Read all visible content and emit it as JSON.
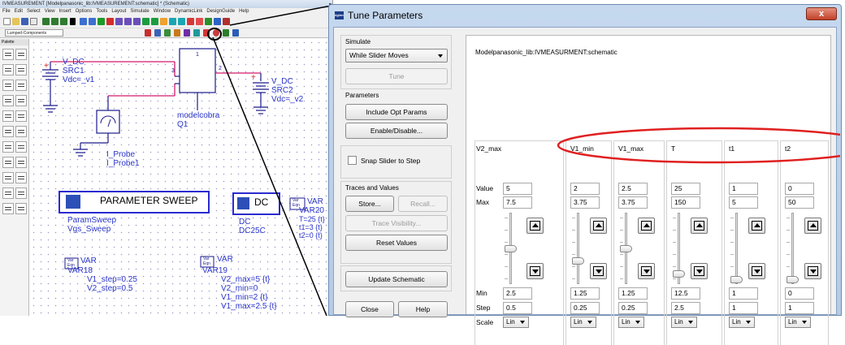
{
  "ads": {
    "window_title": "IVMEASUREMENT [Modelpanasonic_lib:IVMEASUREMENT:schematic] * (Schematic)",
    "menu": [
      "File",
      "Edit",
      "Select",
      "View",
      "Insert",
      "Options",
      "Tools",
      "Layout",
      "Simulate",
      "Window",
      "DynamicLink",
      "DesignGuide",
      "Help"
    ],
    "combo_value": "Lumped-Components",
    "palette_title": "Palette",
    "canvas": {
      "src1": {
        "name": "V_DC",
        "inst": "SRC1",
        "param": "Vdc=_v1"
      },
      "src2": {
        "name": "V_DC",
        "inst": "SRC2",
        "param": "Vdc=_v2"
      },
      "device": {
        "model": "modelcobra",
        "inst": "Q1",
        "pin1": "1",
        "pin2": "2",
        "pin3": "3"
      },
      "probe": {
        "name": "I_Probe",
        "inst": "I_Probe1"
      },
      "sweep": {
        "label": "PARAMETER SWEEP",
        "name": "ParamSweep",
        "inst": "Vgs_Sweep"
      },
      "dc": {
        "label": "DC",
        "name": "DC",
        "inst": "DC25C"
      },
      "var20": {
        "title": "VAR",
        "inst": "VAR20",
        "lines": [
          "T=25 {t}",
          "t1=3 {t}",
          "t2=0 {t}"
        ]
      },
      "var18": {
        "title": "VAR",
        "inst": "VAR18",
        "lines": [
          "V1_step=0.25",
          "V2_step=0.5"
        ]
      },
      "var19": {
        "title": "VAR",
        "inst": "VAR19",
        "lines": [
          "V2_max=5 {t}",
          "V2_min=0",
          "V1_min=2 {t}",
          "V1_max=2.5 {t}"
        ]
      },
      "var_badge_top": "Var",
      "var_badge_bottom": "Eqn"
    }
  },
  "dialog": {
    "title": "Tune Parameters",
    "icon_label": "Agilent",
    "close_label": "x",
    "simulate_label": "Simulate",
    "simulate_mode": "While Slider Moves",
    "tune_label": "Tune",
    "parameters_label": "Parameters",
    "include_opt_label": "Include Opt Params",
    "enable_disable_label": "Enable/Disable...",
    "snap_label": "Snap Slider to Step",
    "snap_checked": false,
    "traces_label": "Traces and Values",
    "store_label": "Store...",
    "recall_label": "Recall...",
    "trace_vis_label": "Trace Visibility...",
    "reset_label": "Reset Values",
    "update_label": "Update Schematic",
    "close_button": "Close",
    "help_button": "Help",
    "design_path": "Modelpanasonic_lib:IVMEASURMENT:schematic",
    "row_labels": {
      "value": "Value",
      "max": "Max",
      "min": "Min",
      "step": "Step",
      "scale": "Scale"
    },
    "params": [
      {
        "name": "V2_max",
        "value": "5",
        "max": "7.5",
        "min": "2.5",
        "step": "0.5",
        "scale": "Lin",
        "slider_fraction": 0.5
      },
      {
        "name": "V1_min",
        "value": "2",
        "max": "3.75",
        "min": "1.25",
        "step": "0.25",
        "scale": "Lin",
        "slider_fraction": 0.3
      },
      {
        "name": "V1_max",
        "value": "2.5",
        "max": "3.75",
        "min": "1.25",
        "step": "0.25",
        "scale": "Lin",
        "slider_fraction": 0.5
      },
      {
        "name": "T",
        "value": "25",
        "max": "150",
        "min": "12.5",
        "step": "2.5",
        "scale": "Lin",
        "slider_fraction": 0.09
      },
      {
        "name": "t1",
        "value": "1",
        "max": "5",
        "min": "1",
        "step": "1",
        "scale": "Lin",
        "slider_fraction": 0.0
      },
      {
        "name": "t2",
        "value": "0",
        "max": "50",
        "min": "0",
        "step": "1",
        "scale": "Lin",
        "slider_fraction": 0.0
      }
    ],
    "highlight_color": "#e02020"
  }
}
